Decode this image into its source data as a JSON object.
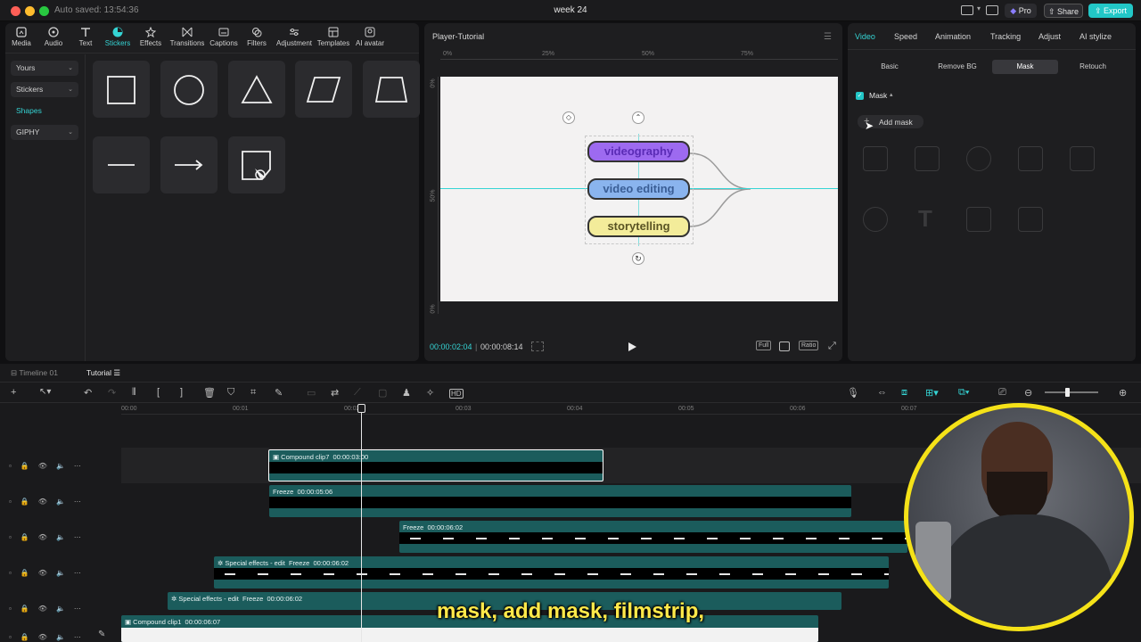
{
  "titlebar": {
    "autosaved": "Auto saved: 13:54:36",
    "title": "week 24",
    "pro_label": "Pro",
    "share_label": "Share",
    "export_label": "Export"
  },
  "media_toolbar": [
    {
      "label": "Media",
      "icon": "media-icon"
    },
    {
      "label": "Audio",
      "icon": "audio-icon"
    },
    {
      "label": "Text",
      "icon": "text-icon"
    },
    {
      "label": "Stickers",
      "icon": "stickers-icon",
      "active": true
    },
    {
      "label": "Effects",
      "icon": "effects-icon"
    },
    {
      "label": "Transitions",
      "icon": "transitions-icon"
    },
    {
      "label": "Captions",
      "icon": "captions-icon"
    },
    {
      "label": "Filters",
      "icon": "filters-icon"
    },
    {
      "label": "Adjustment",
      "icon": "adjustment-icon"
    },
    {
      "label": "Templates",
      "icon": "templates-icon"
    },
    {
      "label": "AI avatar",
      "icon": "ai-avatar-icon"
    }
  ],
  "sidebar": {
    "items": [
      {
        "label": "Yours"
      },
      {
        "label": "Stickers"
      },
      {
        "label": "Shapes",
        "active": true
      },
      {
        "label": "GIPHY"
      }
    ]
  },
  "shapes": [
    "square",
    "circle",
    "triangle",
    "parallelogram",
    "trapezoid",
    "line",
    "arrow",
    "custom-pen"
  ],
  "player": {
    "title": "Player-Tutorial",
    "ruler_top": [
      "0%",
      "25%",
      "50%",
      "75%"
    ],
    "ruler_left": [
      "0%",
      "50%",
      "0%"
    ],
    "pills": [
      {
        "text": "videography",
        "color": "#9d6af0"
      },
      {
        "text": "video editing",
        "color": "#8ab4ee"
      },
      {
        "text": "storytelling",
        "color": "#f3ec9a"
      }
    ],
    "current_time": "00:00:02:04",
    "total_time": "00:00:08:14",
    "controls": [
      "Full",
      "Ratio"
    ]
  },
  "inspector": {
    "tabs": [
      "Video",
      "Speed",
      "Animation",
      "Tracking",
      "Adjust",
      "AI stylize"
    ],
    "active_tab": "Video",
    "subtabs": [
      "Basic",
      "Remove BG",
      "Mask",
      "Retouch"
    ],
    "active_subtab": "Mask",
    "mask_label": "Mask",
    "add_mask_label": "Add mask"
  },
  "timeline": {
    "tabs": [
      {
        "label": "Timeline 01"
      },
      {
        "label": "Tutorial",
        "active": true
      }
    ],
    "ticks": [
      "00:00",
      "00:01",
      "00:02",
      "00:03",
      "00:04",
      "00:05",
      "00:06",
      "00:07"
    ],
    "clips": [
      {
        "name": "Compound clip7",
        "duration": "00:00:03:00"
      },
      {
        "name": "Freeze",
        "duration": "00:00:05:06"
      },
      {
        "name": "Freeze",
        "duration": "00:00:06:02"
      },
      {
        "name": "Special effects - edit",
        "tag": "Freeze",
        "duration": "00:00:06:02"
      },
      {
        "name": "Special effects - edit",
        "tag": "Freeze",
        "duration": "00:00:06:02"
      },
      {
        "name": "Compound clip1",
        "duration": "00:00:06:07"
      }
    ]
  },
  "subtitle": "mask, add mask, filmstrip,"
}
